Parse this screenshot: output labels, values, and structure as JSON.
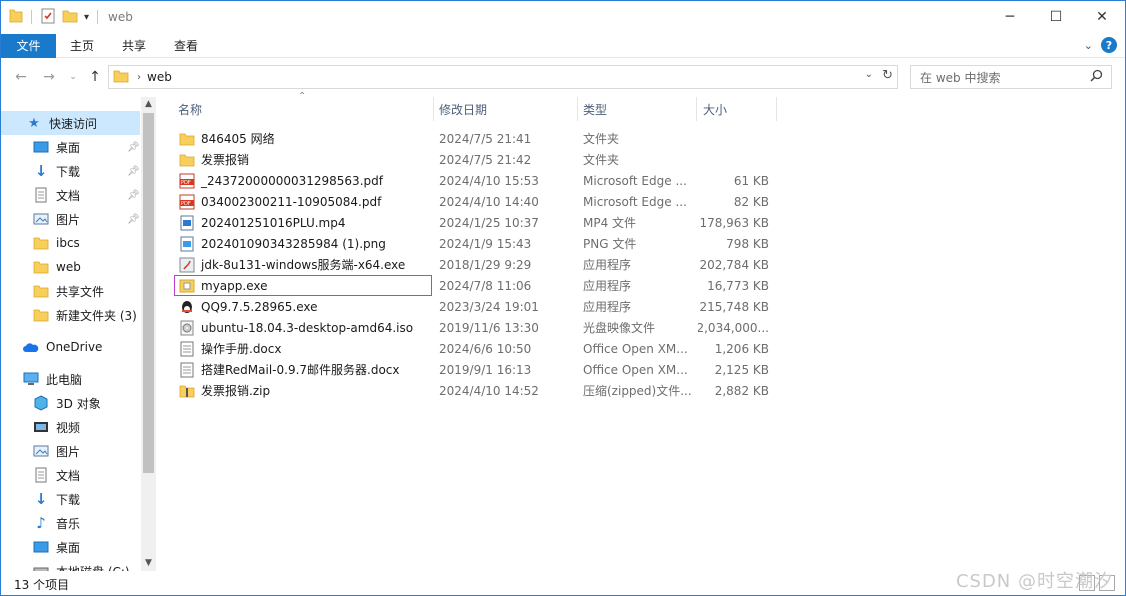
{
  "window": {
    "title": "web"
  },
  "ribbon": {
    "tabs": [
      "文件",
      "主页",
      "共享",
      "查看"
    ]
  },
  "address": {
    "crumb": "web"
  },
  "search": {
    "placeholder": "在 web 中搜索"
  },
  "sidebar": {
    "items": [
      {
        "label": "快速访问",
        "icon": "star-icon"
      },
      {
        "label": "桌面",
        "icon": "desktop-icon",
        "pinned": true
      },
      {
        "label": "下载",
        "icon": "download-icon",
        "pinned": true
      },
      {
        "label": "文档",
        "icon": "document-icon",
        "pinned": true
      },
      {
        "label": "图片",
        "icon": "picture-icon",
        "pinned": true
      },
      {
        "label": "ibcs",
        "icon": "folder-icon"
      },
      {
        "label": "web",
        "icon": "folder-icon"
      },
      {
        "label": "共享文件",
        "icon": "folder-icon"
      },
      {
        "label": "新建文件夹 (3)",
        "icon": "folder-icon"
      },
      {
        "label": "OneDrive",
        "icon": "cloud-icon"
      },
      {
        "label": "此电脑",
        "icon": "computer-icon"
      },
      {
        "label": "3D 对象",
        "icon": "cube-icon"
      },
      {
        "label": "视频",
        "icon": "video-icon"
      },
      {
        "label": "图片",
        "icon": "picture-icon"
      },
      {
        "label": "文档",
        "icon": "document-icon"
      },
      {
        "label": "下载",
        "icon": "download-icon"
      },
      {
        "label": "音乐",
        "icon": "music-icon"
      },
      {
        "label": "桌面",
        "icon": "desktop-icon"
      },
      {
        "label": "本地磁盘 (C:)",
        "icon": "drive-icon"
      }
    ]
  },
  "columns": {
    "name": "名称",
    "date": "修改日期",
    "type": "类型",
    "size": "大小"
  },
  "files": [
    {
      "name": "846405 网络",
      "date": "2024/7/5 21:41",
      "type": "文件夹",
      "size": "",
      "icon": "folder-icon"
    },
    {
      "name": "发票报销",
      "date": "2024/7/5 21:42",
      "type": "文件夹",
      "size": "",
      "icon": "folder-icon"
    },
    {
      "name": "_24372000000031298563.pdf",
      "date": "2024/4/10 15:53",
      "type": "Microsoft Edge ...",
      "size": "61 KB",
      "icon": "pdf-icon"
    },
    {
      "name": "034002300211-10905084.pdf",
      "date": "2024/4/10 14:40",
      "type": "Microsoft Edge ...",
      "size": "82 KB",
      "icon": "pdf-icon"
    },
    {
      "name": "202401251016PLU.mp4",
      "date": "2024/1/25 10:37",
      "type": "MP4 文件",
      "size": "178,963 KB",
      "icon": "video-file-icon"
    },
    {
      "name": "20240109034328598​4 (1).png",
      "date": "2024/1/9 15:43",
      "type": "PNG 文件",
      "size": "798 KB",
      "icon": "image-file-icon"
    },
    {
      "name": "jdk-8u131-windows服务端-x64.exe",
      "date": "2018/1/29 9:29",
      "type": "应用程序",
      "size": "202,784 KB",
      "icon": "java-installer-icon"
    },
    {
      "name": "myapp.exe",
      "date": "2024/7/8 11:06",
      "type": "应用程序",
      "size": "16,773 KB",
      "icon": "app-icon"
    },
    {
      "name": "QQ9.7.5.28965.exe",
      "date": "2023/3/24 19:01",
      "type": "应用程序",
      "size": "215,748 KB",
      "icon": "qq-icon"
    },
    {
      "name": "ubuntu-18.04.3-desktop-amd64.iso",
      "date": "2019/11/6 13:30",
      "type": "光盘映像文件",
      "size": "2,034,000...",
      "icon": "disc-icon"
    },
    {
      "name": "操作手册.docx",
      "date": "2024/6/6 10:50",
      "type": "Office Open XM...",
      "size": "1,206 KB",
      "icon": "docx-icon"
    },
    {
      "name": "搭建RedMail-0.9.7邮件服务器.docx",
      "date": "2019/9/1 16:13",
      "type": "Office Open XM...",
      "size": "2,125 KB",
      "icon": "docx-icon"
    },
    {
      "name": "发票报销.zip",
      "date": "2024/4/10 14:52",
      "type": "压缩(zipped)文件...",
      "size": "2,882 KB",
      "icon": "zip-icon"
    }
  ],
  "status": {
    "count": "13 个项目"
  },
  "watermark": "CSDN @时空潮汐",
  "colors": {
    "accent": "#1979ca",
    "selection_outline": "#c23bd4",
    "nav_active": "#cce8ff"
  }
}
